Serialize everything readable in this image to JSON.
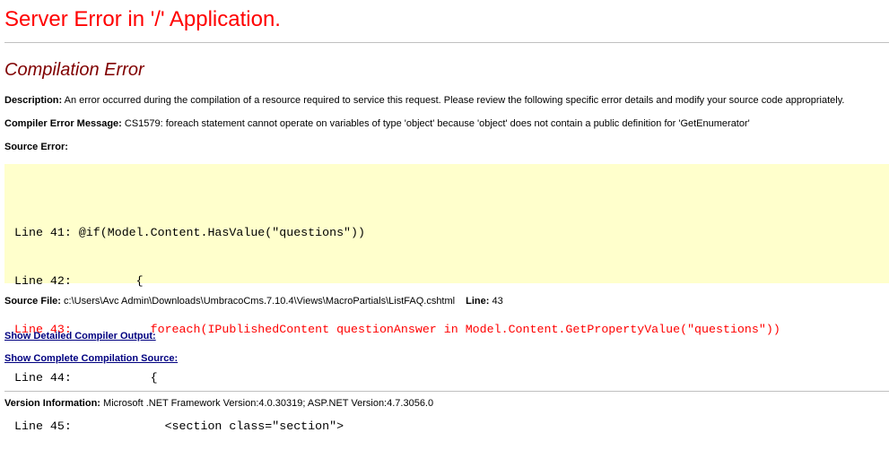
{
  "title": "Server Error in '/' Application.",
  "heading": "Compilation Error",
  "description": {
    "label": "Description:",
    "text": " An error occurred during the compilation of a resource required to service this request. Please review the following specific error details and modify your source code appropriately."
  },
  "compiler_message": {
    "label": "Compiler Error Message:",
    "text": " CS1579: foreach statement cannot operate on variables of type 'object' because 'object' does not contain a public definition for 'GetEnumerator'"
  },
  "source_error": {
    "label": "Source Error:"
  },
  "code_lines": [
    {
      "text": "Line 41: @if(Model.Content.HasValue(\"questions\"))",
      "error": false
    },
    {
      "text": "Line 42:         {",
      "error": false
    },
    {
      "text": "Line 43:           foreach(IPublishedContent questionAnswer in Model.Content.GetPropertyValue(\"questions\"))",
      "error": true
    },
    {
      "text": "Line 44:           {",
      "error": false
    },
    {
      "text": "Line 45:             <section class=\"section\">",
      "error": false
    }
  ],
  "source_file": {
    "label": "Source File:",
    "path": " c:\\Users\\Avc Admin\\Downloads\\UmbracoCms.7.10.4\\Views\\MacroPartials\\ListFAQ.cshtml",
    "line_label": "Line:",
    "line_value": " 43"
  },
  "links": {
    "compiler_output": "Show Detailed Compiler Output:",
    "compilation_source": "Show Complete Compilation Source:"
  },
  "version": {
    "label": "Version Information:",
    "text": " Microsoft .NET Framework Version:4.0.30319; ASP.NET Version:4.7.3056.0"
  },
  "colors": {
    "title": "#ff0000",
    "heading": "#800000",
    "code_background": "#ffffcc",
    "error_line": "#ff0000",
    "link": "#000080"
  }
}
